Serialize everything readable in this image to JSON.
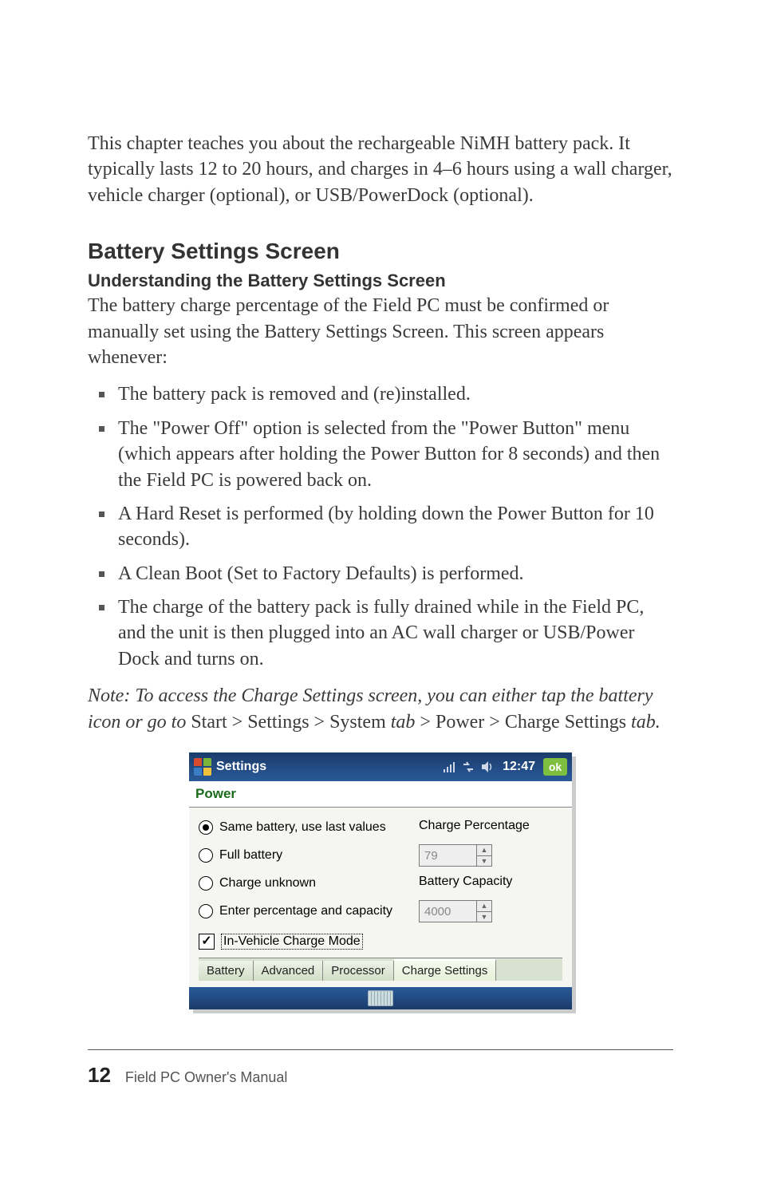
{
  "intro": "This chapter teaches you about the rechargeable NiMH battery pack. It typically lasts 12 to 20 hours, and charges in 4–6 hours using a wall charger, vehicle charger (optional), or USB/PowerDock (optional).",
  "section_heading": "Battery Settings Screen",
  "subsection_heading": "Understanding the Battery Settings Screen",
  "para1": "The battery charge percentage of the Field PC must be confirmed or manually set using the Battery Settings Screen. This screen appears whenever:",
  "bullets": [
    "The battery pack is removed and (re)installed.",
    "The \"Power Off\" option is selected from the \"Power Button\" menu (which appears after holding the Power Button for 8 seconds) and then the Field PC is powered back on.",
    "A Hard Reset is performed (by holding down the Power Button for 10 seconds).",
    "A Clean Boot (Set to Factory Defaults) is performed.",
    "The charge of the battery pack is fully drained while in the Field PC, and the unit is then plugged into an AC wall charger or USB/Power Dock and turns on."
  ],
  "note": {
    "pre": "Note: To access the Charge Settings screen, you can either tap the battery icon or go to ",
    "mid": "Start > Settings > System ",
    "tab1": "tab",
    "sep": " > ",
    "power": "Power > Charge Settings ",
    "tab2": "tab."
  },
  "screenshot": {
    "titlebar": {
      "app": "Settings",
      "clock": "12:47",
      "ok": "ok"
    },
    "subtitle": "Power",
    "radios": {
      "same": "Same battery, use last values",
      "full": "Full battery",
      "unknown": "Charge unknown",
      "enter": "Enter percentage and capacity"
    },
    "labels": {
      "charge_pct": "Charge Percentage",
      "capacity": "Battery Capacity"
    },
    "values": {
      "charge_pct": "79",
      "capacity": "4000"
    },
    "checkbox": "In-Vehicle Charge Mode",
    "tabs": [
      "Battery",
      "Advanced",
      "Processor",
      "Charge Settings"
    ]
  },
  "footer": {
    "page": "12",
    "text": "Field PC Owner's Manual"
  }
}
